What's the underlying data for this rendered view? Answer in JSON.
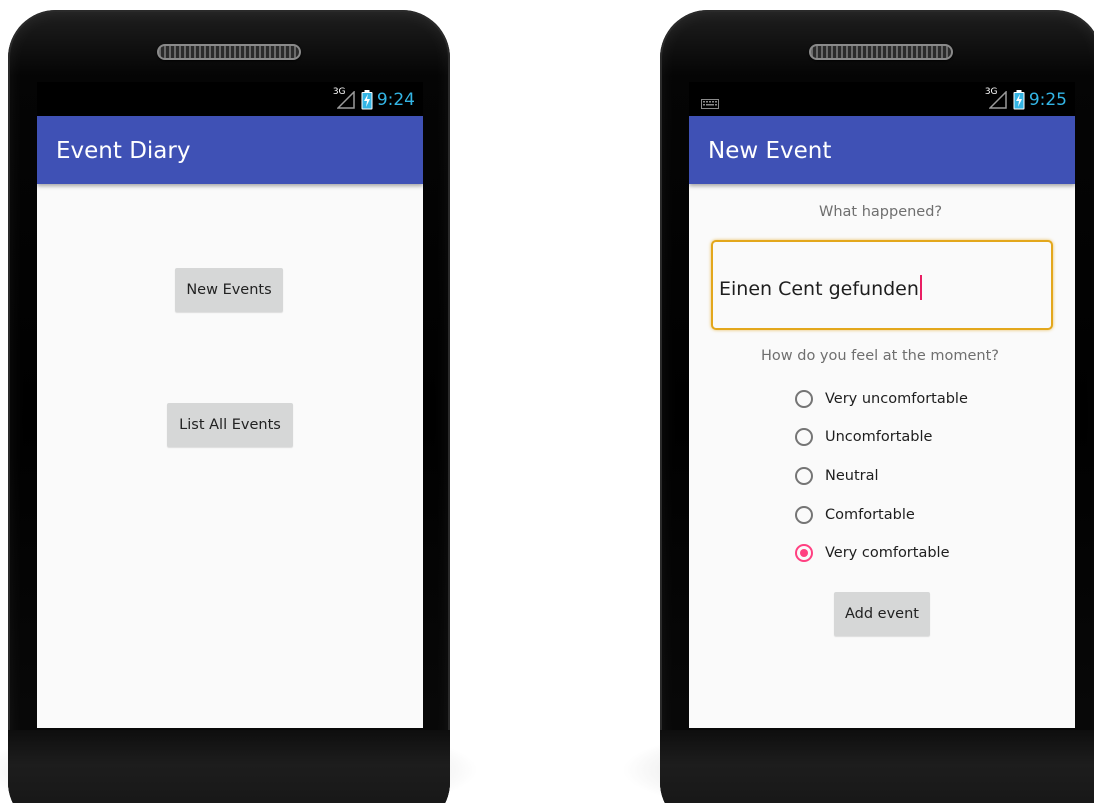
{
  "left_phone": {
    "status_bar": {
      "network": "3G",
      "time": "9:24"
    },
    "app_bar": {
      "title": "Event Diary"
    },
    "buttons": {
      "new_events": "New Events",
      "list_all_events": "List All Events"
    }
  },
  "right_phone": {
    "status_bar": {
      "network": "3G",
      "time": "9:25",
      "keyboard_icon": "keyboard-icon"
    },
    "app_bar": {
      "title": "New Event"
    },
    "what_happened_label": "What happened?",
    "event_input_value": "Einen Cent gefunden",
    "feeling_label": "How do you feel at the moment?",
    "feelings": [
      {
        "label": "Very uncomfortable",
        "checked": false
      },
      {
        "label": "Uncomfortable",
        "checked": false
      },
      {
        "label": "Neutral",
        "checked": false
      },
      {
        "label": "Comfortable",
        "checked": false
      },
      {
        "label": "Very comfortable",
        "checked": true
      }
    ],
    "add_event_label": "Add event"
  },
  "colors": {
    "app_bar": "#3f51b5",
    "status_text": "#33b5e5",
    "accent": "#ff4081",
    "input_border": "#e3a71c",
    "button_bg": "#d6d7d7",
    "screen_bg": "#fafafa"
  }
}
